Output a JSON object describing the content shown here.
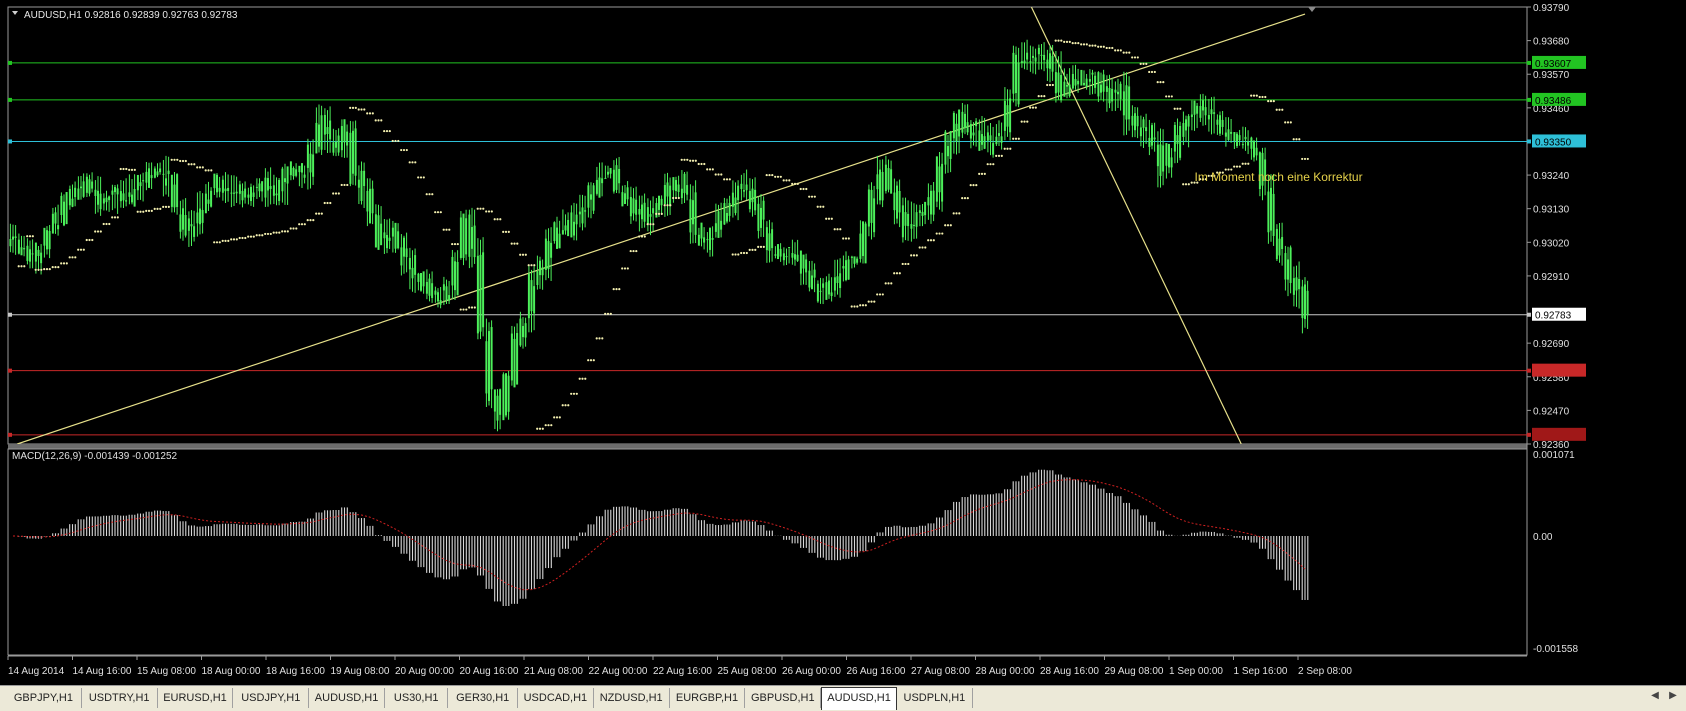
{
  "header": {
    "symbol_label": "AUDUSD,H1",
    "ohlc": "0.92816 0.92839 0.92763 0.92783"
  },
  "price_axis": {
    "ticks": [
      "0.93790",
      "0.93680",
      "0.93570",
      "0.93460",
      "0.93240",
      "0.93130",
      "0.93020",
      "0.92910",
      "0.92690",
      "0.92580",
      "0.92470",
      "0.92360"
    ]
  },
  "levels": [
    {
      "price": 0.93607,
      "label": "0.93607",
      "line_color": "#22c422",
      "badge_color": "#22c422",
      "badge_text_color": "#000000"
    },
    {
      "price": 0.93486,
      "label": "0.93486",
      "line_color": "#22c422",
      "badge_color": "#22c422",
      "badge_text_color": "#000000"
    },
    {
      "price": 0.9335,
      "label": "0.93350",
      "line_color": "#2ec0d8",
      "badge_color": "#2ec0d8",
      "badge_text_color": "#000000"
    },
    {
      "price": 0.92783,
      "label": "0.92783",
      "line_color": "#c8c8c8",
      "badge_color": "#ffffff",
      "badge_text_color": "#000000"
    },
    {
      "price": 0.926,
      "label": "",
      "line_color": "#c82828",
      "badge_color": "#c82828",
      "badge_text_color": "#ffffff"
    },
    {
      "price": 0.9239,
      "label": "",
      "line_color": "#c82828",
      "badge_color": "#a01818",
      "badge_text_color": "#ffffff"
    }
  ],
  "annotation": {
    "text": "Im Moment noch eine Korrektur",
    "color": "#e6d24a"
  },
  "trendlines": [
    {
      "x1": 0.5,
      "p1": 0.9236,
      "x2": 152,
      "p2": 0.93767,
      "color": "#e6e08a"
    },
    {
      "x1": 119.5,
      "p1": 0.93808,
      "x2": 144.5,
      "p2": 0.9236,
      "color": "#e6e08a"
    }
  ],
  "macd": {
    "label": "MACD(12,26,9) -0.001439 -0.001252",
    "ticks": [
      "0.001071",
      "0.00",
      "-0.001558"
    ]
  },
  "time_axis": {
    "labels": [
      "14 Aug 2014",
      "14 Aug 16:00",
      "15 Aug 08:00",
      "18 Aug 00:00",
      "18 Aug 16:00",
      "19 Aug 08:00",
      "20 Aug 00:00",
      "20 Aug 16:00",
      "21 Aug 08:00",
      "22 Aug 00:00",
      "22 Aug 16:00",
      "25 Aug 08:00",
      "26 Aug 00:00",
      "26 Aug 16:00",
      "27 Aug 08:00",
      "28 Aug 00:00",
      "28 Aug 16:00",
      "29 Aug 08:00",
      "1 Sep 00:00",
      "1 Sep 16:00",
      "2 Sep 08:00"
    ]
  },
  "tabs": [
    {
      "label": "GBPJPY,H1",
      "active": false
    },
    {
      "label": "USDTRY,H1",
      "active": false
    },
    {
      "label": "EURUSD,H1",
      "active": false
    },
    {
      "label": "USDJPY,H1",
      "active": false
    },
    {
      "label": "AUDUSD,H1",
      "active": false
    },
    {
      "label": "US30,H1",
      "active": false
    },
    {
      "label": "GER30,H1",
      "active": false
    },
    {
      "label": "USDCAD,H1",
      "active": false
    },
    {
      "label": "NZDUSD,H1",
      "active": false
    },
    {
      "label": "EURGBP,H1",
      "active": false
    },
    {
      "label": "GBPUSD,H1",
      "active": false
    },
    {
      "label": "AUDUSD,H1",
      "active": true
    },
    {
      "label": "USDPLN,H1",
      "active": false
    }
  ],
  "colors": {
    "background": "#000000",
    "candle": "#4cf05a",
    "sar_dots": "#f4f0b0",
    "macd_hist": "#d8d8d8",
    "macd_signal": "#d02020",
    "grid_frame": "#9a9a9a",
    "text": "#e0e0e0"
  },
  "chart_data": {
    "type": "candlestick",
    "symbol": "AUDUSD",
    "timeframe": "H1",
    "y_range": [
      0.9236,
      0.9379
    ],
    "close_path_hint": "Approximate closing price per bar (153 bars), read from the chart",
    "closes": [
      0.9302,
      0.93,
      0.9297,
      0.93,
      0.9306,
      0.931,
      0.9316,
      0.9318,
      0.9322,
      0.932,
      0.9315,
      0.9317,
      0.9318,
      0.9316,
      0.932,
      0.9322,
      0.9325,
      0.9325,
      0.9322,
      0.9313,
      0.9306,
      0.9308,
      0.9314,
      0.9318,
      0.9322,
      0.932,
      0.9319,
      0.9317,
      0.9319,
      0.9321,
      0.9318,
      0.932,
      0.9325,
      0.9326,
      0.9324,
      0.9332,
      0.9342,
      0.9336,
      0.9333,
      0.934,
      0.9323,
      0.9318,
      0.931,
      0.9302,
      0.9306,
      0.9302,
      0.9296,
      0.9291,
      0.9288,
      0.9285,
      0.9284,
      0.9287,
      0.9297,
      0.9309,
      0.9298,
      0.9272,
      0.9252,
      0.9245,
      0.9257,
      0.927,
      0.9277,
      0.929,
      0.9295,
      0.9302,
      0.9307,
      0.9306,
      0.931,
      0.9314,
      0.9319,
      0.9324,
      0.9325,
      0.932,
      0.9316,
      0.9313,
      0.931,
      0.9312,
      0.9316,
      0.932,
      0.9322,
      0.9318,
      0.9306,
      0.9302,
      0.9305,
      0.931,
      0.9314,
      0.9319,
      0.932,
      0.9314,
      0.9307,
      0.93,
      0.9298,
      0.9298,
      0.9297,
      0.9292,
      0.9288,
      0.9285,
      0.9288,
      0.9292,
      0.9295,
      0.9297,
      0.9307,
      0.9318,
      0.9326,
      0.932,
      0.9312,
      0.9306,
      0.931,
      0.9313,
      0.9317,
      0.9328,
      0.9336,
      0.9343,
      0.934,
      0.9338,
      0.9333,
      0.9336,
      0.9339,
      0.9349,
      0.9363,
      0.9363,
      0.9362,
      0.9364,
      0.9359,
      0.9351,
      0.9354,
      0.9356,
      0.9355,
      0.9356,
      0.9352,
      0.935,
      0.9352,
      0.9342,
      0.934,
      0.9338,
      0.9334,
      0.9325,
      0.9332,
      0.9338,
      0.9343,
      0.9346,
      0.9345,
      0.9342,
      0.9339,
      0.9336,
      0.9335,
      0.9334,
      0.9331,
      0.932,
      0.9305,
      0.9298,
      0.929,
      0.9286,
      0.9278
    ]
  }
}
